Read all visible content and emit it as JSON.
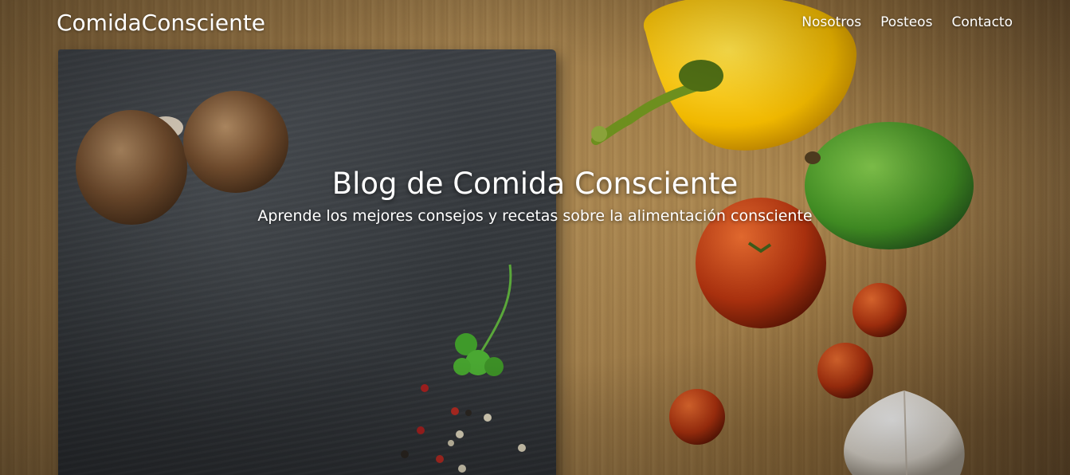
{
  "header": {
    "brand": "ComidaConsciente",
    "nav": [
      "Nosotros",
      "Posteos",
      "Contacto"
    ]
  },
  "hero": {
    "title": "Blog de Comida Consciente",
    "subtitle": "Aprende los mejores consejos y recetas sobre la alimentación consciente"
  },
  "colors": {
    "wood": "#9c7b4a",
    "slate": "#33373b",
    "text": "#ffffff"
  }
}
